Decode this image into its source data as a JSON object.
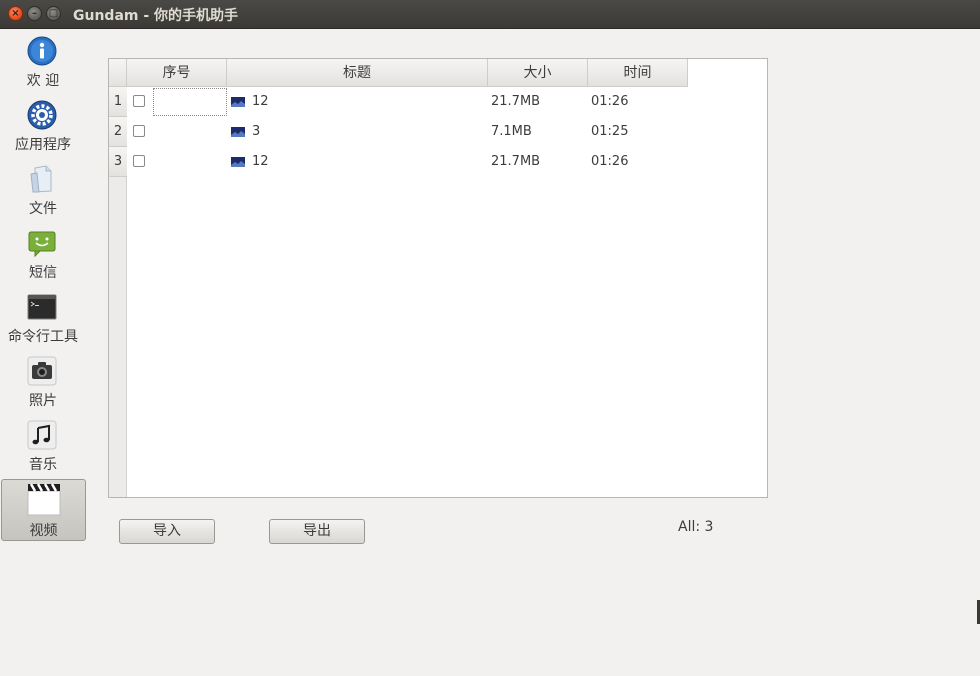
{
  "window": {
    "title": "Gundam - 你的手机助手"
  },
  "sidebar": {
    "items": [
      {
        "label": "欢 迎",
        "icon": "info-icon"
      },
      {
        "label": "应用程序",
        "icon": "gear-icon"
      },
      {
        "label": "文件",
        "icon": "file-icon"
      },
      {
        "label": "短信",
        "icon": "sms-icon"
      },
      {
        "label": "命令行工具",
        "icon": "terminal-icon"
      },
      {
        "label": "照片",
        "icon": "camera-icon"
      },
      {
        "label": "音乐",
        "icon": "music-icon"
      },
      {
        "label": "视频",
        "icon": "video-clapper-icon"
      }
    ],
    "active": "视频"
  },
  "table": {
    "columns": [
      "序号",
      "标题",
      "大小",
      "时间"
    ],
    "rows": [
      {
        "num": "1",
        "title": "12",
        "size": "21.7MB",
        "time": "01:26"
      },
      {
        "num": "2",
        "title": "3",
        "size": "7.1MB",
        "time": "01:25"
      },
      {
        "num": "3",
        "title": "12",
        "size": "21.7MB",
        "time": "01:26"
      }
    ]
  },
  "actions": {
    "import_label": "导入",
    "export_label": "导出"
  },
  "status": {
    "count": "All: 3"
  },
  "colors": {
    "titlebar": "#3c3b37",
    "close": "#df4a16",
    "info_blue": "#2a6fc0",
    "sms_green": "#7ab03a"
  }
}
